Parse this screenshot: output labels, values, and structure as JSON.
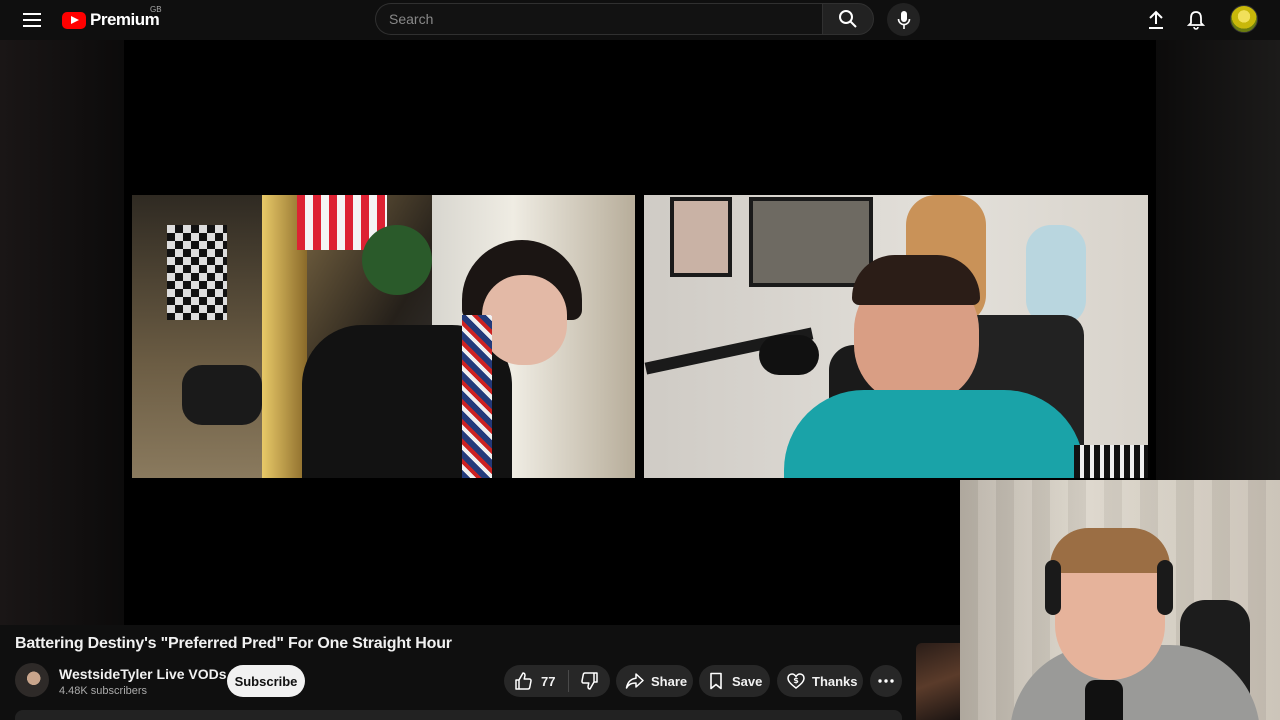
{
  "header": {
    "brand": "Premium",
    "region": "GB",
    "search_placeholder": "Search",
    "icons": [
      "menu-icon",
      "search-icon",
      "mic-icon",
      "upload-icon",
      "bell-icon",
      "avatar"
    ]
  },
  "video": {
    "title": "Battering Destiny's \"Preferred Pred\" For One Straight Hour",
    "channel_name": "WestsideTyler Live VODs",
    "subscribers": "4.48K subscribers",
    "subscribe_label": "Subscribe",
    "like_count": "77",
    "share_label": "Share",
    "save_label": "Save",
    "thanks_label": "Thanks"
  },
  "colors": {
    "background": "#0f0f0f",
    "brand_red": "#ff0000",
    "pill_bg": "#272727",
    "subscribe_bg": "#f1f1f1"
  }
}
